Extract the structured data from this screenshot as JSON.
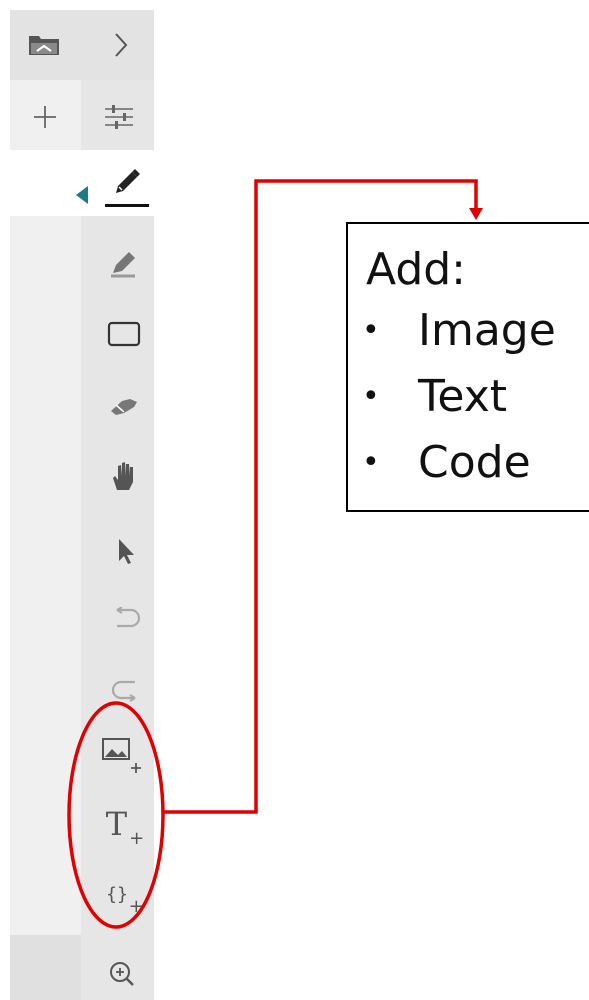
{
  "toolbar": {
    "top": [
      {
        "name": "open-folder-icon",
        "label": "Open"
      },
      {
        "name": "chevron-right-icon",
        "label": "Expand"
      },
      {
        "name": "plus-icon",
        "label": "New"
      },
      {
        "name": "sliders-icon",
        "label": "Settings"
      }
    ],
    "tools": [
      "pen-icon",
      "highlighter-icon",
      "rectangle-icon",
      "eraser-icon",
      "hand-icon",
      "pointer-icon",
      "undo-icon",
      "redo-icon",
      "add-image-icon",
      "add-text-icon",
      "add-code-icon",
      "zoom-in-icon"
    ],
    "add_text_glyph": "T",
    "add_code_glyph": "{}",
    "plus_glyph": "+",
    "colors": {
      "accent": "#1a7a8a",
      "highlight": "#e00000",
      "icon": "#555555"
    }
  },
  "callout": {
    "title": "Add:",
    "items": [
      "Image",
      "Text",
      "Code"
    ],
    "bullet": "•"
  }
}
